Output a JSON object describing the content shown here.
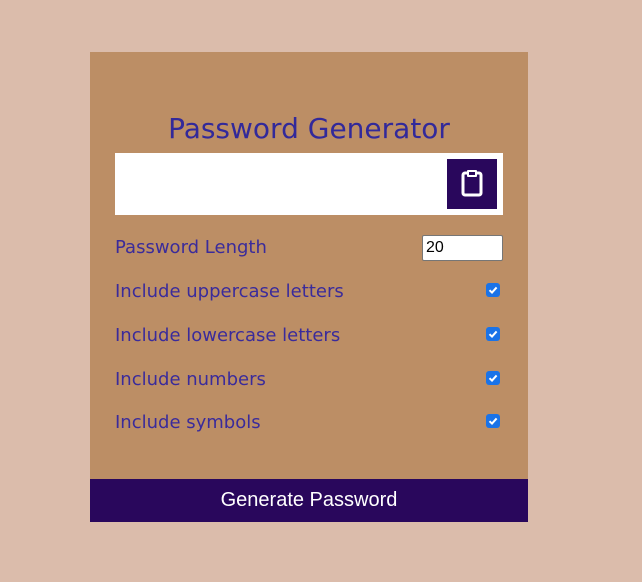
{
  "app": {
    "title": "Password Generator"
  },
  "result": {
    "value": "",
    "copy_icon": "clipboard-icon"
  },
  "settings": {
    "length": {
      "label": "Password Length",
      "value": "20"
    },
    "uppercase": {
      "label": "Include uppercase letters",
      "checked": true
    },
    "lowercase": {
      "label": "Include lowercase letters",
      "checked": true
    },
    "numbers": {
      "label": "Include numbers",
      "checked": true
    },
    "symbols": {
      "label": "Include symbols",
      "checked": true
    }
  },
  "actions": {
    "generate_label": "Generate Password"
  },
  "colors": {
    "page_background": "#dbbcab",
    "card_background": "#bc8e65",
    "title_text": "#32299a",
    "label_text": "#3a2b9b",
    "button_background": "#29075c",
    "checkbox_accent": "#1a73e8"
  }
}
